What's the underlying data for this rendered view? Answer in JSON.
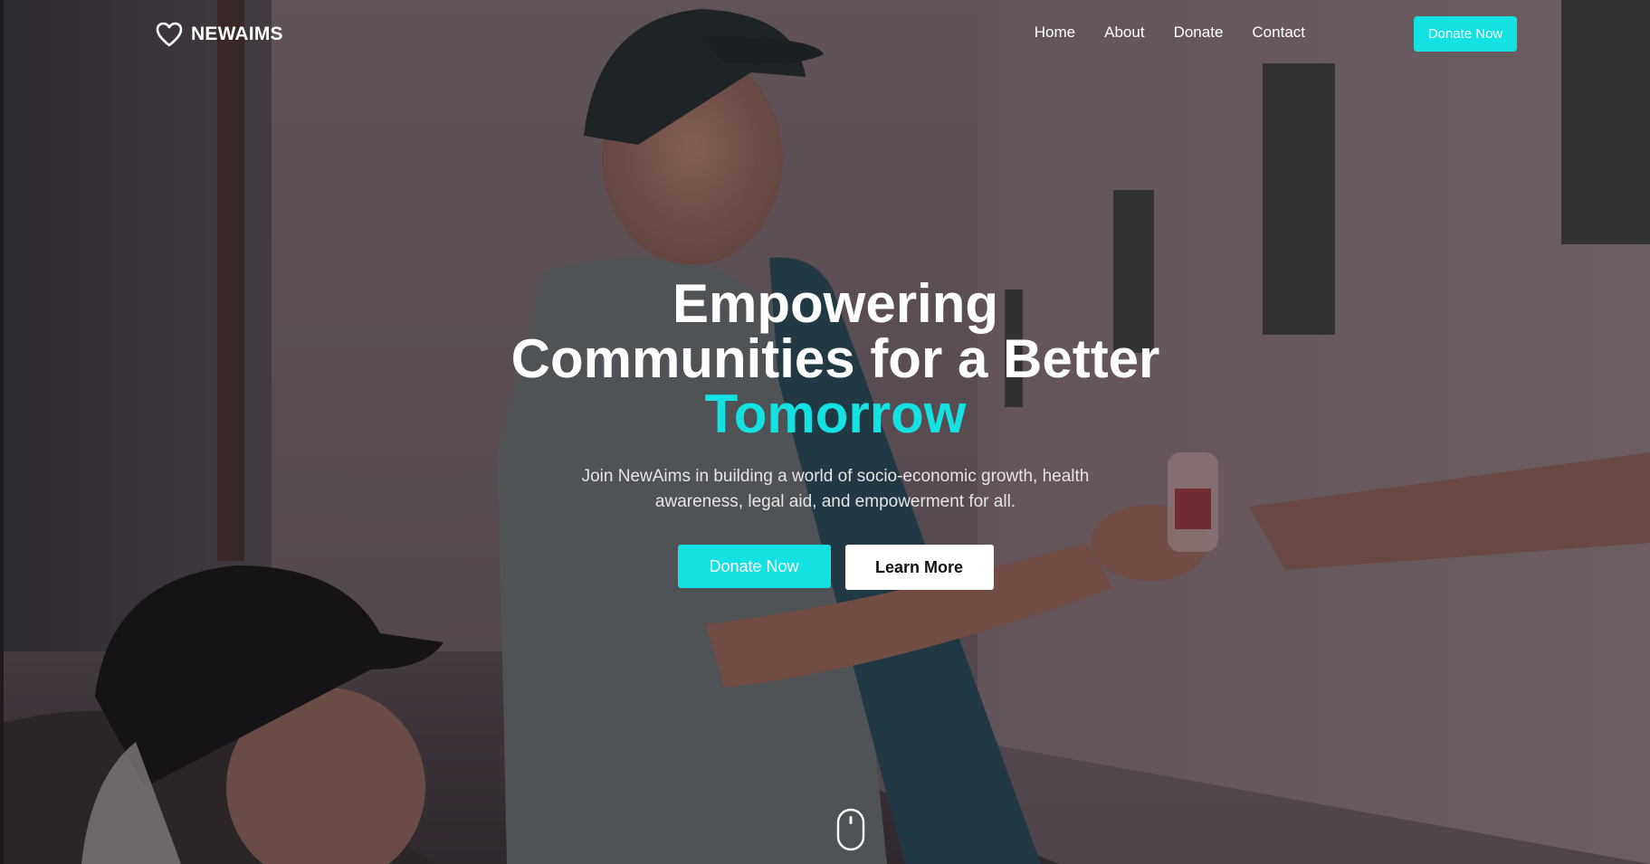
{
  "brand": {
    "name": "NEWAIMS",
    "icon": "heart-outline-icon"
  },
  "nav": {
    "links": [
      "Home",
      "About",
      "Donate",
      "Contact"
    ],
    "cta_label": "Donate Now"
  },
  "hero": {
    "title_line1": "Empowering",
    "title_line2": "Communities for a Better",
    "title_accent": "Tomorrow",
    "subtitle": "Join NewAims in building a world of socio-economic growth, health awareness, legal aid, and empowerment for all.",
    "primary_label": "Donate Now",
    "secondary_label": "Learn More",
    "scroll_icon": "mouse-scroll-icon"
  },
  "colors": {
    "accent": "#14e2e2",
    "text": "#ffffff",
    "button_secondary_bg": "#ffffff"
  }
}
